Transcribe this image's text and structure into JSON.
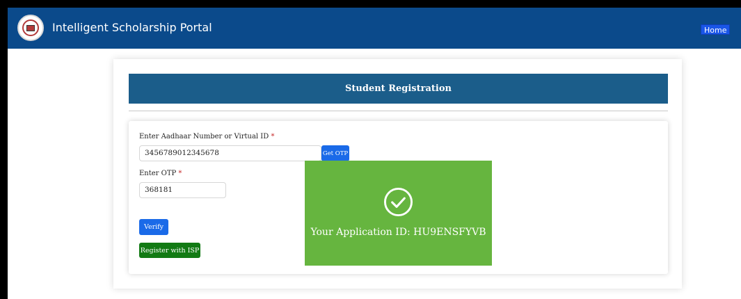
{
  "app": {
    "title": "Intelligent Scholarship Portal",
    "home_label": "Home",
    "logo_icon": "portal-logo-icon"
  },
  "form": {
    "heading": "Student Registration",
    "aadhaar_label": "Enter Aadhaar Number or Virtual ID",
    "aadhaar_value": "3456789012345678",
    "get_otp_label": "Get OTP",
    "otp_label": "Enter OTP",
    "otp_value": "368181",
    "required_mark": "*",
    "verify_label": "Verify",
    "register_label": "Register with ISP"
  },
  "success": {
    "message": "Your Application ID: HU9ENSFYVB",
    "icon": "check-circle-icon"
  },
  "colors": {
    "navbar": "#0b4a8b",
    "header_bar": "#1b5d8a",
    "primary_button": "#1a6ae8",
    "success_button": "#127a14",
    "success_panel": "#66b53f"
  }
}
